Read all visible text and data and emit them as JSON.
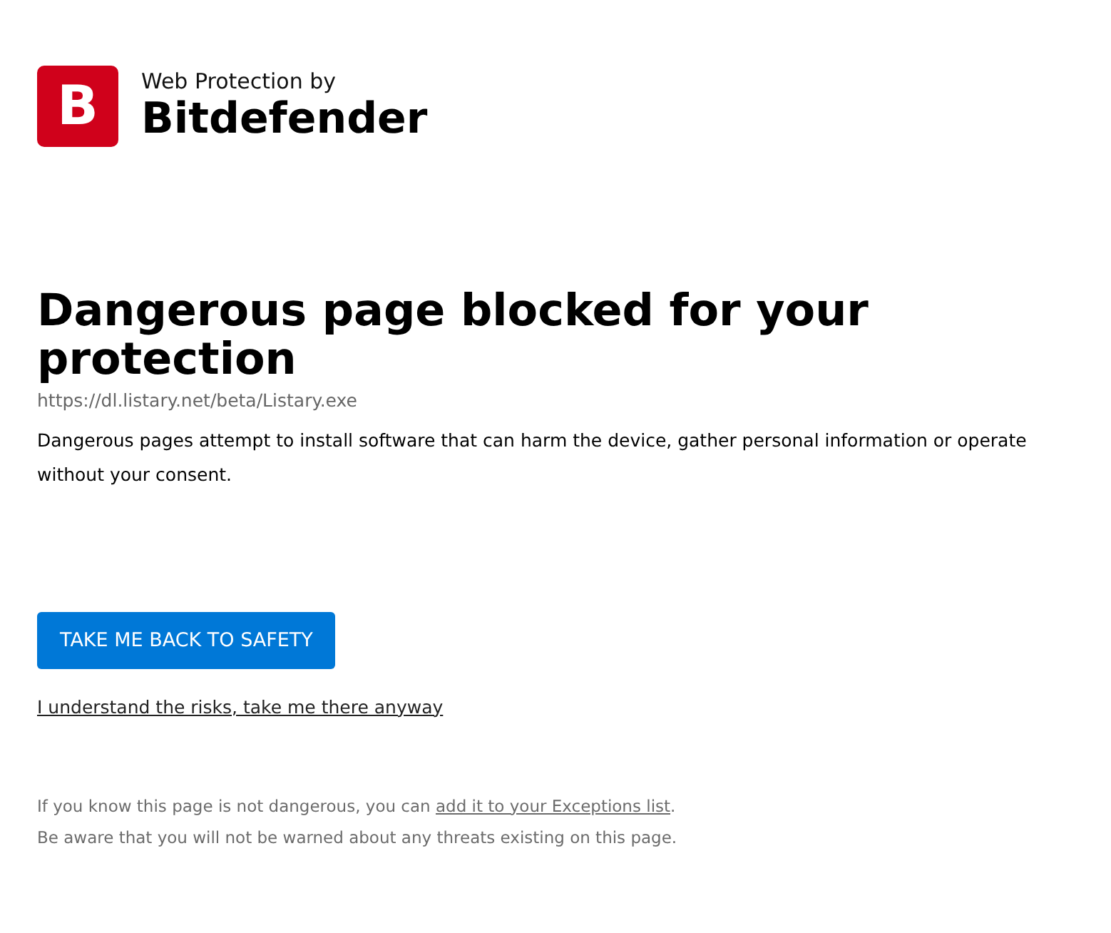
{
  "brand": {
    "logo_letter": "B",
    "tagline": "Web Protection by",
    "name": "Bitdefender"
  },
  "heading": "Dangerous page blocked for your protection",
  "url": "https://dl.listary.net/beta/Listary.exe",
  "description": "Dangerous pages attempt to install software that can harm the device, gather personal information or operate without your consent.",
  "primary_button": "TAKE ME BACK TO SAFETY",
  "proceed_link": "I understand the risks, take me there anyway",
  "footnote": {
    "before": "If you know this page is not dangerous, you can ",
    "link": "add it to your Exceptions list",
    "after": "."
  },
  "warning": "Be aware that you will not be warned about any threats existing on this page."
}
